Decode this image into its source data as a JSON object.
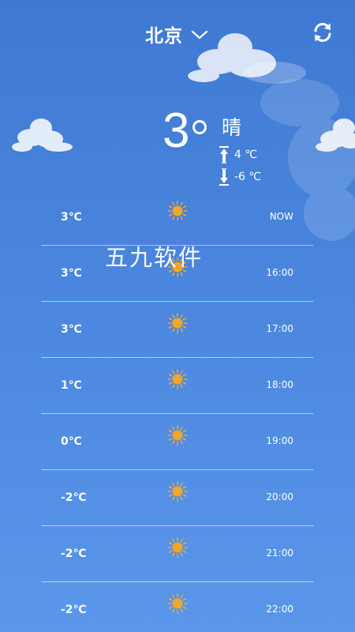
{
  "header": {
    "city": "北京",
    "city_selector_icon": "chevron-down-icon",
    "refresh_icon": "refresh-icon"
  },
  "current": {
    "temp": "3",
    "condition": "晴",
    "high": "4 ℃",
    "low": "-6 ℃"
  },
  "watermark": "五九软件",
  "hourly": [
    {
      "temp": "3℃",
      "icon": "sun-icon",
      "time": "NOW"
    },
    {
      "temp": "3℃",
      "icon": "sun-icon",
      "time": "16:00"
    },
    {
      "temp": "3℃",
      "icon": "sun-icon",
      "time": "17:00"
    },
    {
      "temp": "1℃",
      "icon": "sun-icon",
      "time": "18:00"
    },
    {
      "temp": "0℃",
      "icon": "sun-icon",
      "time": "19:00"
    },
    {
      "temp": "-2℃",
      "icon": "sun-icon",
      "time": "20:00"
    },
    {
      "temp": "-2℃",
      "icon": "sun-icon",
      "time": "21:00"
    },
    {
      "temp": "-2℃",
      "icon": "sun-icon",
      "time": "22:00"
    }
  ],
  "colors": {
    "sky_top": "#3f79d3",
    "sky_bottom": "#5a97ea",
    "sun": "#f5a623"
  }
}
